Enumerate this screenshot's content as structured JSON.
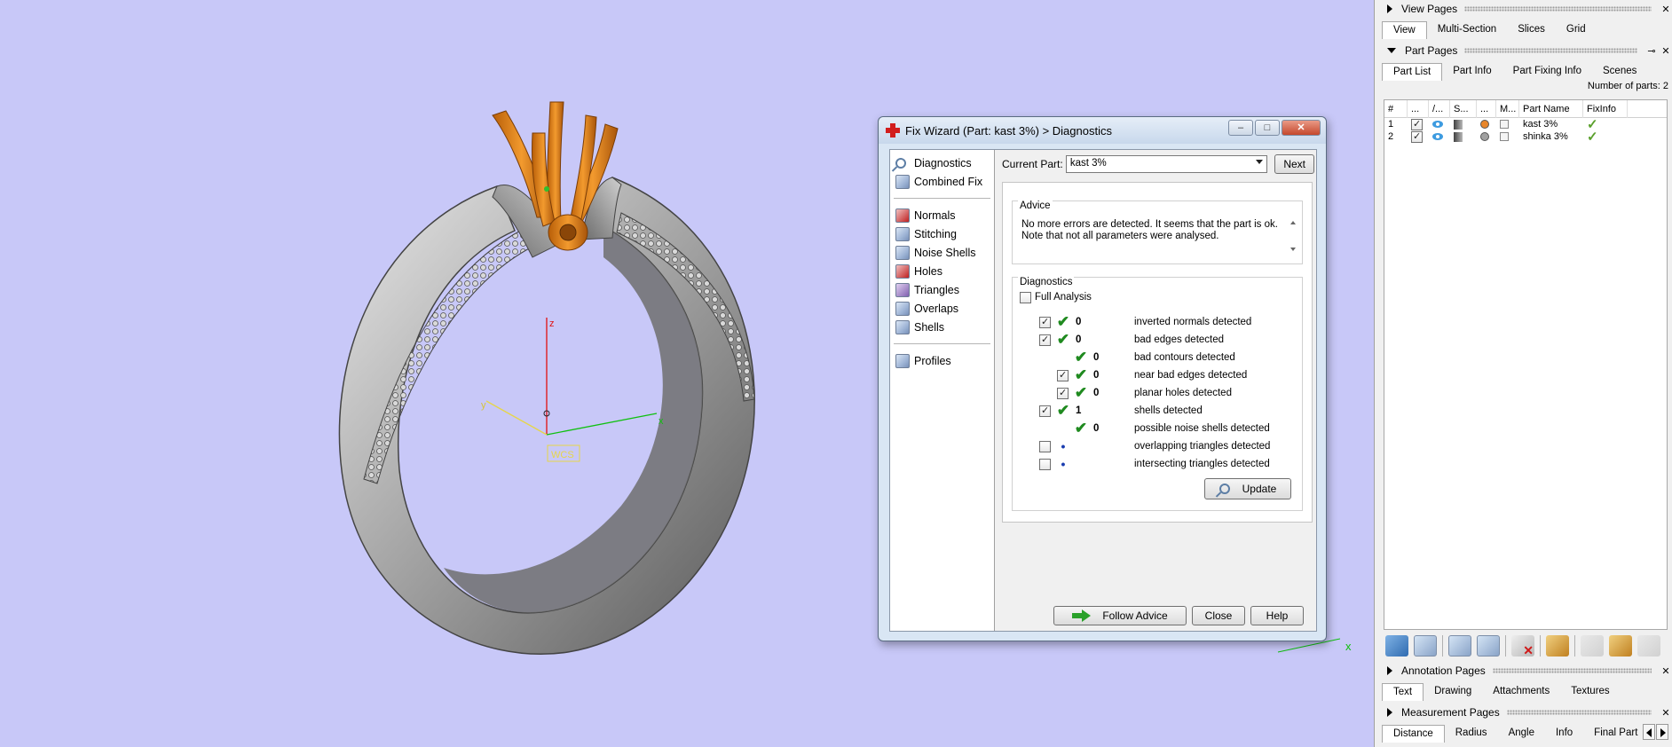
{
  "viewport": {
    "axis_labels": {
      "x": "x",
      "y": "y",
      "z": "z"
    },
    "wcs_label": "WCS",
    "colors": {
      "background": "#c8c8f8",
      "ring": "#9a9a9a",
      "prongs": "#e88a1a"
    }
  },
  "dialog": {
    "title": "Fix Wizard (Part: kast 3%) > Diagnostics",
    "nav": [
      {
        "label": "Diagnostics",
        "icon": "magnifier-icon"
      },
      {
        "label": "Combined Fix",
        "icon": "cube-icon"
      },
      {
        "label": "Normals",
        "icon": "normals-cube-icon"
      },
      {
        "label": "Stitching",
        "icon": "stitching-cube-icon"
      },
      {
        "label": "Noise Shells",
        "icon": "noise-shells-icon"
      },
      {
        "label": "Holes",
        "icon": "holes-cube-icon"
      },
      {
        "label": "Triangles",
        "icon": "triangles-cube-icon"
      },
      {
        "label": "Overlaps",
        "icon": "overlaps-cube-icon"
      },
      {
        "label": "Shells",
        "icon": "shells-cube-icon"
      },
      {
        "label": "Profiles",
        "icon": "profiles-cube-icon"
      }
    ],
    "current_part_label": "Current Part:",
    "current_part_value": "kast 3%",
    "next_label": "Next",
    "advice_title": "Advice",
    "advice_text": "No more errors are detected. It seems that the part is ok. Note that not all parameters were analysed.",
    "diagnostics_title": "Diagnostics",
    "full_analysis_label": "Full Analysis",
    "rows": [
      {
        "checked": true,
        "status": "ok",
        "count": "0",
        "label": "inverted normals detected",
        "indent": 0,
        "has_checkbox": true
      },
      {
        "checked": true,
        "status": "ok",
        "count": "0",
        "label": "bad edges detected",
        "indent": 0,
        "has_checkbox": true
      },
      {
        "checked": false,
        "status": "ok",
        "count": "0",
        "label": "bad contours detected",
        "indent": 1,
        "has_checkbox": false
      },
      {
        "checked": true,
        "status": "ok",
        "count": "0",
        "label": "near bad edges detected",
        "indent": 1,
        "has_checkbox": true
      },
      {
        "checked": true,
        "status": "ok",
        "count": "0",
        "label": "planar holes detected",
        "indent": 1,
        "has_checkbox": true
      },
      {
        "checked": true,
        "status": "ok",
        "count": "1",
        "label": "shells detected",
        "indent": 0,
        "has_checkbox": true
      },
      {
        "checked": false,
        "status": "ok",
        "count": "0",
        "label": "possible noise shells detected",
        "indent": 1,
        "has_checkbox": false
      },
      {
        "checked": false,
        "status": "dot",
        "count": "",
        "label": "overlapping triangles detected",
        "indent": 0,
        "has_checkbox": true
      },
      {
        "checked": false,
        "status": "dot",
        "count": "",
        "label": "intersecting triangles detected",
        "indent": 0,
        "has_checkbox": true
      }
    ],
    "update_label": "Update",
    "follow_advice_label": "Follow Advice",
    "close_label": "Close",
    "help_label": "Help"
  },
  "side": {
    "view_pages": {
      "title": "View Pages",
      "tabs": [
        "View",
        "Multi-Section",
        "Slices",
        "Grid"
      ],
      "active": 0
    },
    "part_pages": {
      "title": "Part Pages",
      "tabs": [
        "Part List",
        "Part Info",
        "Part Fixing Info",
        "Scenes"
      ],
      "active": 0,
      "part_count": "Number of parts: 2",
      "columns": [
        "#",
        "...",
        "/...",
        "S...",
        "...",
        "M...",
        "Part Name",
        "FixInfo"
      ],
      "rows": [
        {
          "num": "1",
          "name": "kast 3%",
          "color": "#e8862a"
        },
        {
          "num": "2",
          "name": "shinka 3%",
          "color": "#a0a0a0"
        }
      ]
    },
    "annotation_pages": {
      "title": "Annotation Pages",
      "tabs": [
        "Text",
        "Drawing",
        "Attachments",
        "Textures"
      ],
      "active": 0
    },
    "measurement_pages": {
      "title": "Measurement Pages",
      "tabs": [
        "Distance",
        "Radius",
        "Angle",
        "Info",
        "Final Part"
      ],
      "active": 0
    }
  }
}
